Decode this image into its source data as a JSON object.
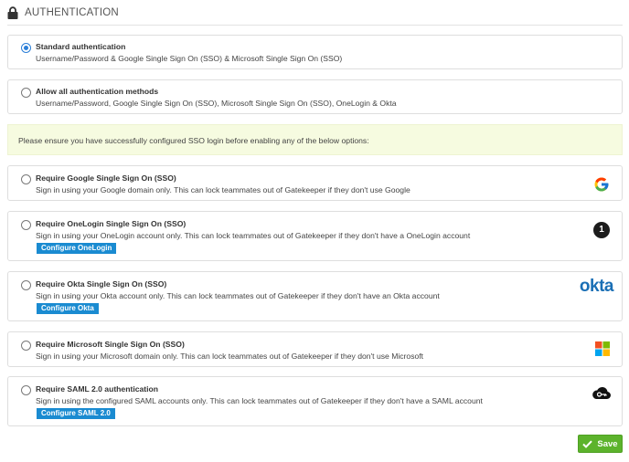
{
  "section": {
    "title": "AUTHENTICATION",
    "icon": "lock-icon"
  },
  "options": [
    {
      "title": "Standard authentication",
      "description": "Username/Password & Google Single Sign On (SSO) & Microsoft Single Sign On (SSO)",
      "selected": true
    },
    {
      "title": "Allow all authentication methods",
      "description": "Username/Password, Google Single Sign On (SSO), Microsoft Single Sign On (SSO), OneLogin & Okta",
      "selected": false
    }
  ],
  "notice": "Please ensure you have successfully configured SSO login before enabling any of the below options:",
  "sso_options": [
    {
      "title": "Require Google Single Sign On (SSO)",
      "description": "Sign in using your Google domain only. This can lock teammates out of Gatekeeper if they don't use Google",
      "logo": "google-logo",
      "selected": false
    },
    {
      "title": "Require OneLogin Single Sign On (SSO)",
      "description": "Sign in using your OneLogin account only. This can lock teammates out of Gatekeeper if they don't have a OneLogin account",
      "config_label": "Configure OneLogin",
      "logo": "onelogin-logo",
      "logo_text": "1",
      "selected": false
    },
    {
      "title": "Require Okta Single Sign On (SSO)",
      "description": "Sign in using your Okta account only. This can lock teammates out of Gatekeeper if they don't have an Okta account",
      "config_label": "Configure Okta",
      "logo": "okta-logo",
      "logo_text": "okta",
      "selected": false
    },
    {
      "title": "Require Microsoft Single Sign On (SSO)",
      "description": "Sign in using your Microsoft domain only. This can lock teammates out of Gatekeeper if they don't use Microsoft",
      "logo": "microsoft-logo",
      "selected": false
    },
    {
      "title": "Require SAML 2.0 authentication",
      "description": "Sign in using the configured SAML accounts only. This can lock teammates out of Gatekeeper if they don't have a SAML account",
      "config_label": "Configure SAML 2.0",
      "logo": "saml-cloud-key-logo",
      "selected": false
    }
  ],
  "save_label": "Save",
  "colors": {
    "accent_blue": "#1a8bd1",
    "radio_selected": "#2b7fd8",
    "save_green": "#5cb32c",
    "notice_bg": "#f6fbe0",
    "okta_blue": "#1a6fb5"
  }
}
